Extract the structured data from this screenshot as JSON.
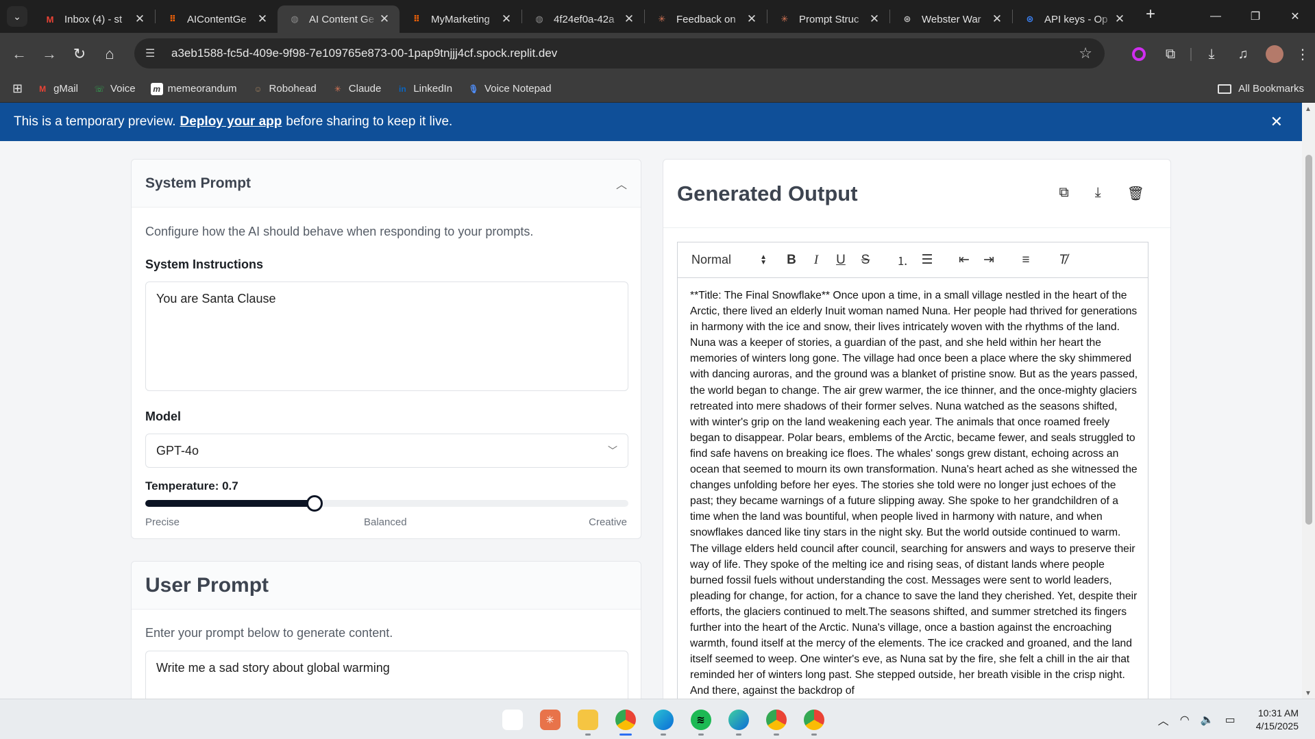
{
  "browser": {
    "tabs": [
      {
        "title": "Inbox (4) - st",
        "icon": "gmail-icon",
        "color": "#ea4335",
        "glyph": "M"
      },
      {
        "title": "AIContentGe",
        "icon": "replit-icon",
        "color": "#f26207",
        "glyph": "⠿"
      },
      {
        "title": "AI Content Ge",
        "icon": "globe-icon",
        "color": "#8a8a8a",
        "glyph": "◍",
        "active": true
      },
      {
        "title": "MyMarketing",
        "icon": "replit-icon",
        "color": "#f26207",
        "glyph": "⠿"
      },
      {
        "title": "4f24ef0a-42a",
        "icon": "globe-icon",
        "color": "#8a8a8a",
        "glyph": "◍"
      },
      {
        "title": "Feedback on",
        "icon": "claude-icon",
        "color": "#d97757",
        "glyph": "✳"
      },
      {
        "title": "Prompt Struc",
        "icon": "claude-icon",
        "color": "#d97757",
        "glyph": "✳"
      },
      {
        "title": "Webster War",
        "icon": "openai-icon",
        "color": "#bbbbbb",
        "glyph": "⊛"
      },
      {
        "title": "API keys - Op",
        "icon": "openai-icon",
        "color": "#3b82f6",
        "glyph": "⊛"
      }
    ],
    "url": "a3eb1588-fc5d-409e-9f98-7e109765e873-00-1pap9tnjjj4cf.spock.replit.dev",
    "bookmarks": [
      {
        "label": "gMail",
        "icon": "gmail-icon",
        "color": "#ea4335",
        "glyph": "M"
      },
      {
        "label": "Voice",
        "icon": "voice-icon",
        "color": "#34a853",
        "glyph": "☏"
      },
      {
        "label": "memeorandum",
        "icon": "memeorandum-icon",
        "color": "#ffffff",
        "glyph": "m"
      },
      {
        "label": "Robohead",
        "icon": "robohead-icon",
        "color": "#a08060",
        "glyph": "☺"
      },
      {
        "label": "Claude",
        "icon": "claude-icon",
        "color": "#d97757",
        "glyph": "✳"
      },
      {
        "label": "LinkedIn",
        "icon": "linkedin-icon",
        "color": "#0a66c2",
        "glyph": "in"
      },
      {
        "label": "Voice Notepad",
        "icon": "microphone-icon",
        "color": "#4f8df7",
        "glyph": "🎙"
      }
    ],
    "all_bookmarks": "All Bookmarks"
  },
  "banner": {
    "before": "This is a temporary preview.",
    "link": "Deploy your app",
    "after": "before sharing to keep it live."
  },
  "system_prompt": {
    "title": "System Prompt",
    "description": "Configure how the AI should behave when responding to your prompts.",
    "instructions_label": "System Instructions",
    "instructions_value": "You are Santa Clause",
    "model_label": "Model",
    "model_value": "GPT-4o",
    "temperature_label": "Temperature: 0.7",
    "temperature": 0.7,
    "temperature_ticks": [
      "Precise",
      "Balanced",
      "Creative"
    ]
  },
  "user_prompt": {
    "title": "User Prompt",
    "description": "Enter your prompt below to generate content.",
    "value": "Write me a sad story about global warming"
  },
  "output": {
    "title": "Generated Output",
    "format_select": "Normal",
    "text": "**Title: The Final Snowflake** Once upon a time, in a small village nestled in the heart of the Arctic, there lived an elderly Inuit woman named Nuna. Her people had thrived for generations in harmony with the ice and snow, their lives intricately woven with the rhythms of the land. Nuna was a keeper of stories, a guardian of the past, and she held within her heart the memories of winters long gone. The village had once been a place where the sky shimmered with dancing auroras, and the ground was a blanket of pristine snow. But as the years passed, the world began to change. The air grew warmer, the ice thinner, and the once-mighty glaciers retreated into mere shadows of their former selves. Nuna watched as the seasons shifted, with winter's grip on the land weakening each year. The animals that once roamed freely began to disappear. Polar bears, emblems of the Arctic, became fewer, and seals struggled to find safe havens on breaking ice floes. The whales' songs grew distant, echoing across an ocean that seemed to mourn its own transformation. Nuna's heart ached as she witnessed the changes unfolding before her eyes. The stories she told were no longer just echoes of the past; they became warnings of a future slipping away. She spoke to her grandchildren of a time when the land was bountiful, when people lived in harmony with nature, and when snowflakes danced like tiny stars in the night sky. But the world outside continued to warm. The village elders held council after council, searching for answers and ways to preserve their way of life. They spoke of the melting ice and rising seas, of distant lands where people burned fossil fuels without understanding the cost. Messages were sent to world leaders, pleading for change, for action, for a chance to save the land they cherished. Yet, despite their efforts, the glaciers continued to melt.The seasons shifted, and summer stretched its fingers further into the heart of the Arctic. Nuna's village, once a bastion against the encroaching warmth, found itself at the mercy of the elements. The ice cracked and groaned, and the land itself seemed to weep. One winter's eve, as Nuna sat by the fire, she felt a chill in the air that reminded her of winters long past. She stepped outside, her breath visible in the crisp night. And there, against the backdrop of"
  },
  "taskbar": {
    "time": "10:31 AM",
    "date": "4/15/2025"
  }
}
